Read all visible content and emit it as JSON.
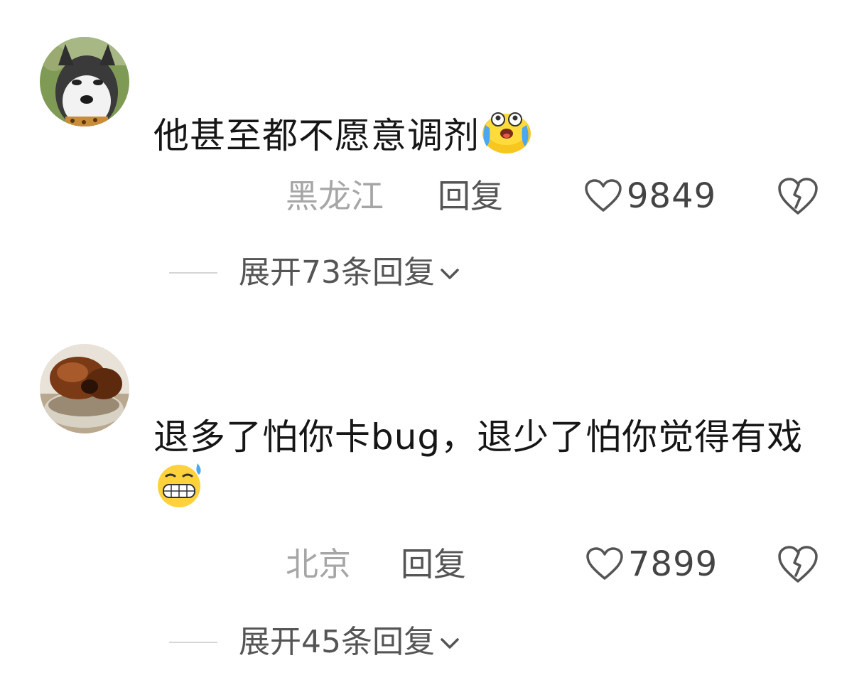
{
  "comments": [
    {
      "text": "他甚至都不愿意调剂",
      "emoji_icon": "crying-laughing-face-icon",
      "location": "黑龙江",
      "reply_label": "回复",
      "like_count": "9849",
      "expand_label": "展开73条回复",
      "avatar": "husky-dog-avatar"
    },
    {
      "text": "退多了怕你卡bug，退少了怕你觉得有戏",
      "emoji_icon": "grimacing-sweat-face-icon",
      "location": "北京",
      "reply_label": "回复",
      "like_count": "7899",
      "expand_label": "展开45条回复",
      "avatar": "chocolate-cake-avatar"
    }
  ],
  "colors": {
    "text": "#161616",
    "location": "#a6a6a6",
    "secondary": "#555555",
    "divider": "#d6d6d6"
  }
}
